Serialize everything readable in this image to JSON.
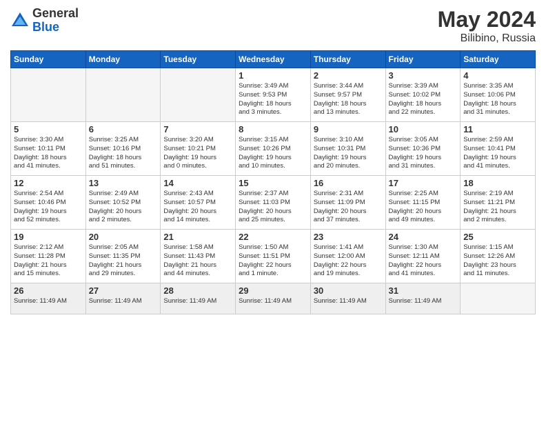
{
  "logo": {
    "general": "General",
    "blue": "Blue"
  },
  "title": "May 2024",
  "subtitle": "Bilibino, Russia",
  "headers": [
    "Sunday",
    "Monday",
    "Tuesday",
    "Wednesday",
    "Thursday",
    "Friday",
    "Saturday"
  ],
  "weeks": [
    {
      "days": [
        {
          "num": "",
          "info": ""
        },
        {
          "num": "",
          "info": ""
        },
        {
          "num": "",
          "info": ""
        },
        {
          "num": "1",
          "info": "Sunrise: 3:49 AM\nSunset: 9:53 PM\nDaylight: 18 hours\nand 3 minutes."
        },
        {
          "num": "2",
          "info": "Sunrise: 3:44 AM\nSunset: 9:57 PM\nDaylight: 18 hours\nand 13 minutes."
        },
        {
          "num": "3",
          "info": "Sunrise: 3:39 AM\nSunset: 10:02 PM\nDaylight: 18 hours\nand 22 minutes."
        },
        {
          "num": "4",
          "info": "Sunrise: 3:35 AM\nSunset: 10:06 PM\nDaylight: 18 hours\nand 31 minutes."
        }
      ]
    },
    {
      "days": [
        {
          "num": "5",
          "info": "Sunrise: 3:30 AM\nSunset: 10:11 PM\nDaylight: 18 hours\nand 41 minutes."
        },
        {
          "num": "6",
          "info": "Sunrise: 3:25 AM\nSunset: 10:16 PM\nDaylight: 18 hours\nand 51 minutes."
        },
        {
          "num": "7",
          "info": "Sunrise: 3:20 AM\nSunset: 10:21 PM\nDaylight: 19 hours\nand 0 minutes."
        },
        {
          "num": "8",
          "info": "Sunrise: 3:15 AM\nSunset: 10:26 PM\nDaylight: 19 hours\nand 10 minutes."
        },
        {
          "num": "9",
          "info": "Sunrise: 3:10 AM\nSunset: 10:31 PM\nDaylight: 19 hours\nand 20 minutes."
        },
        {
          "num": "10",
          "info": "Sunrise: 3:05 AM\nSunset: 10:36 PM\nDaylight: 19 hours\nand 31 minutes."
        },
        {
          "num": "11",
          "info": "Sunrise: 2:59 AM\nSunset: 10:41 PM\nDaylight: 19 hours\nand 41 minutes."
        }
      ]
    },
    {
      "days": [
        {
          "num": "12",
          "info": "Sunrise: 2:54 AM\nSunset: 10:46 PM\nDaylight: 19 hours\nand 52 minutes."
        },
        {
          "num": "13",
          "info": "Sunrise: 2:49 AM\nSunset: 10:52 PM\nDaylight: 20 hours\nand 2 minutes."
        },
        {
          "num": "14",
          "info": "Sunrise: 2:43 AM\nSunset: 10:57 PM\nDaylight: 20 hours\nand 14 minutes."
        },
        {
          "num": "15",
          "info": "Sunrise: 2:37 AM\nSunset: 11:03 PM\nDaylight: 20 hours\nand 25 minutes."
        },
        {
          "num": "16",
          "info": "Sunrise: 2:31 AM\nSunset: 11:09 PM\nDaylight: 20 hours\nand 37 minutes."
        },
        {
          "num": "17",
          "info": "Sunrise: 2:25 AM\nSunset: 11:15 PM\nDaylight: 20 hours\nand 49 minutes."
        },
        {
          "num": "18",
          "info": "Sunrise: 2:19 AM\nSunset: 11:21 PM\nDaylight: 21 hours\nand 2 minutes."
        }
      ]
    },
    {
      "days": [
        {
          "num": "19",
          "info": "Sunrise: 2:12 AM\nSunset: 11:28 PM\nDaylight: 21 hours\nand 15 minutes."
        },
        {
          "num": "20",
          "info": "Sunrise: 2:05 AM\nSunset: 11:35 PM\nDaylight: 21 hours\nand 29 minutes."
        },
        {
          "num": "21",
          "info": "Sunrise: 1:58 AM\nSunset: 11:43 PM\nDaylight: 21 hours\nand 44 minutes."
        },
        {
          "num": "22",
          "info": "Sunrise: 1:50 AM\nSunset: 11:51 PM\nDaylight: 22 hours\nand 1 minute."
        },
        {
          "num": "23",
          "info": "Sunrise: 1:41 AM\nSunset: 12:00 AM\nDaylight: 22 hours\nand 19 minutes."
        },
        {
          "num": "24",
          "info": "Sunrise: 1:30 AM\nSunset: 12:11 AM\nDaylight: 22 hours\nand 41 minutes."
        },
        {
          "num": "25",
          "info": "Sunrise: 1:15 AM\nSunset: 12:26 AM\nDaylight: 23 hours\nand 11 minutes."
        }
      ]
    },
    {
      "days": [
        {
          "num": "26",
          "info": "Sunrise: 11:49 AM"
        },
        {
          "num": "27",
          "info": "Sunrise: 11:49 AM"
        },
        {
          "num": "28",
          "info": "Sunrise: 11:49 AM"
        },
        {
          "num": "29",
          "info": "Sunrise: 11:49 AM"
        },
        {
          "num": "30",
          "info": "Sunrise: 11:49 AM"
        },
        {
          "num": "31",
          "info": "Sunrise: 11:49 AM"
        },
        {
          "num": "",
          "info": ""
        }
      ]
    }
  ]
}
